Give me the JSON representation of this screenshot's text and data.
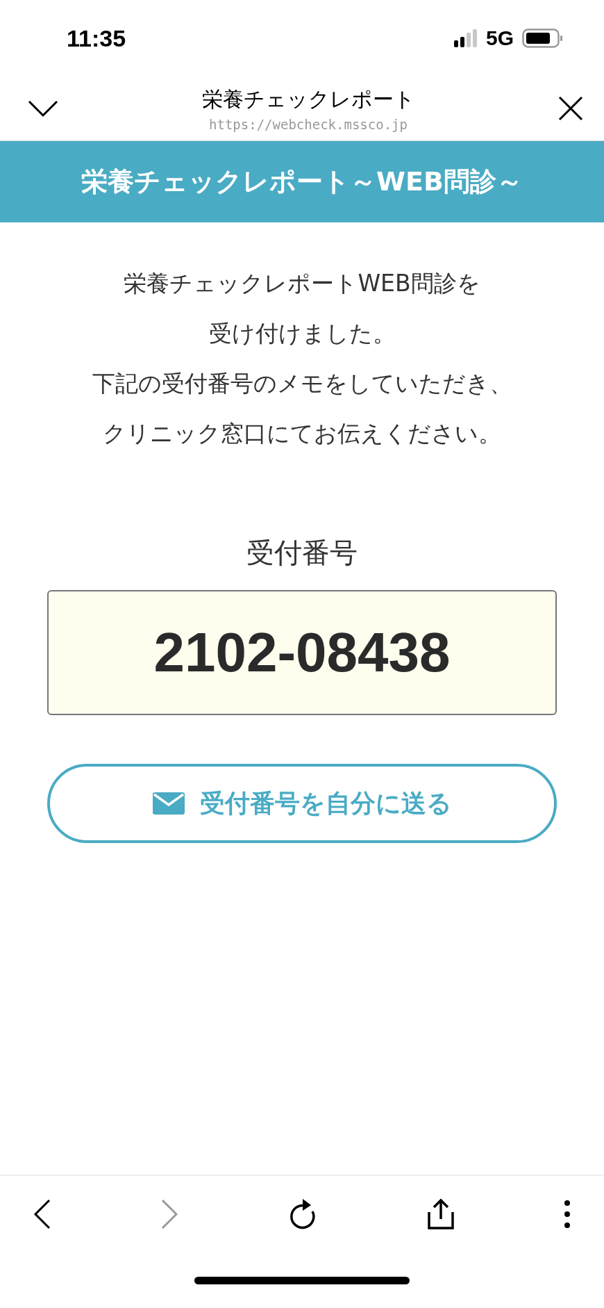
{
  "status_bar": {
    "time": "11:35",
    "network": "5G"
  },
  "browser_header": {
    "title": "栄養チェックレポート",
    "url": "https://webcheck.mssco.jp"
  },
  "banner": {
    "title": "栄養チェックレポート～WEB問診～"
  },
  "message": {
    "lines": [
      "栄養チェックレポートWEB問診を",
      "受け付けました。",
      "下記の受付番号のメモをしていただき、",
      "クリニック窓口にてお伝えください。"
    ]
  },
  "receipt": {
    "label": "受付番号",
    "number": "2102-08438"
  },
  "send_button": {
    "label": "受付番号を自分に送る"
  },
  "toolbar": [
    {
      "kind": "back",
      "disabled": false
    },
    {
      "kind": "forward",
      "disabled": true
    },
    {
      "kind": "reload",
      "disabled": false
    },
    {
      "kind": "share",
      "disabled": false
    },
    {
      "kind": "more",
      "disabled": false
    }
  ]
}
